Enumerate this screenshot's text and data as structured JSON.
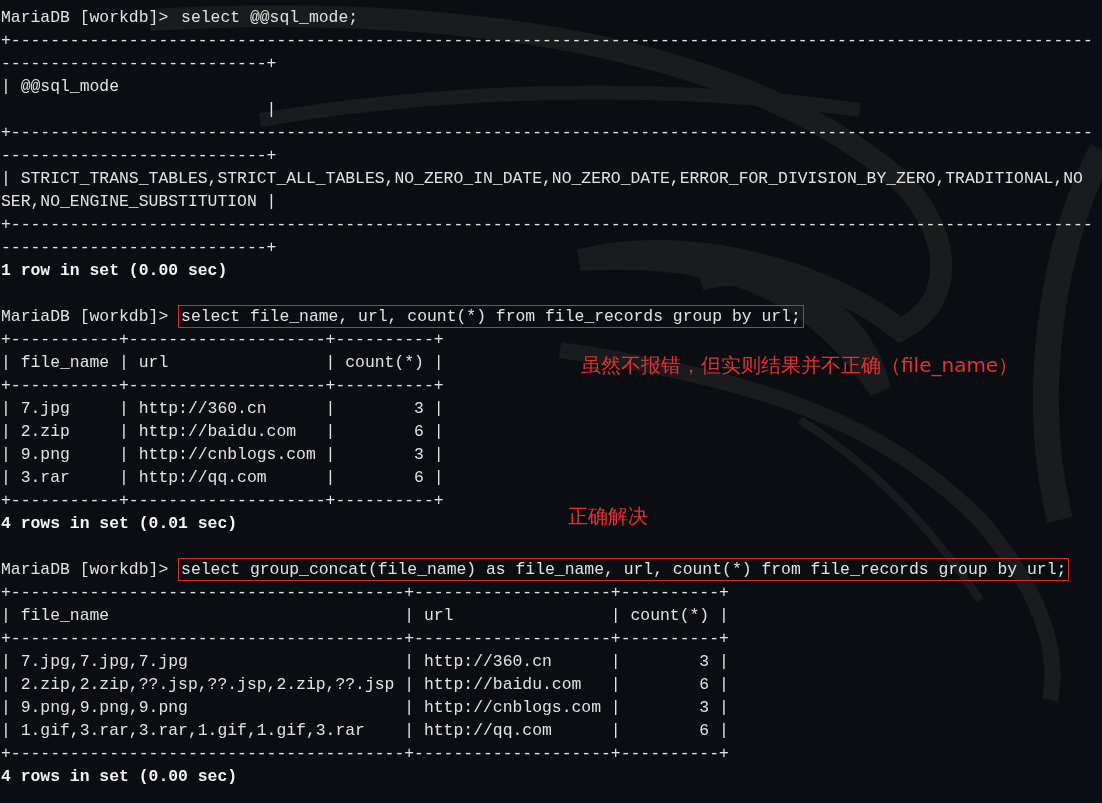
{
  "lines": [
    {
      "kind": "command",
      "prompt": "MariaDB [workdb]> ",
      "command": "select @@sql_mode;",
      "highlighted": false
    },
    {
      "kind": "border",
      "text": "+--------------------------------------------------------------------------------------------------------------"
    },
    {
      "kind": "border",
      "text": "---------------------------+"
    },
    {
      "kind": "row",
      "text": "| @@sql_mode"
    },
    {
      "kind": "row",
      "text": "                           |"
    },
    {
      "kind": "border",
      "text": "+--------------------------------------------------------------------------------------------------------------"
    },
    {
      "kind": "border",
      "text": "---------------------------+"
    },
    {
      "kind": "row",
      "text": "| STRICT_TRANS_TABLES,STRICT_ALL_TABLES,NO_ZERO_IN_DATE,NO_ZERO_DATE,ERROR_FOR_DIVISION_BY_ZERO,TRADITIONAL,NO"
    },
    {
      "kind": "row",
      "text": "SER,NO_ENGINE_SUBSTITUTION |"
    },
    {
      "kind": "border",
      "text": "+--------------------------------------------------------------------------------------------------------------"
    },
    {
      "kind": "border",
      "text": "---------------------------+"
    },
    {
      "kind": "summary",
      "text": "1 row in set (0.00 sec)"
    },
    {
      "kind": "blank"
    },
    {
      "kind": "command",
      "prompt": "MariaDB [workdb]> ",
      "command": "select file_name, url, count(*) from file_records group by url;",
      "highlighted": true
    },
    {
      "kind": "border",
      "text": "+-----------+--------------------+----------+"
    },
    {
      "kind": "row",
      "text": "| file_name | url                | count(*) |",
      "note": "虽然不报错，但实则结果并不正确（file_name）"
    },
    {
      "kind": "border",
      "text": "+-----------+--------------------+----------+"
    },
    {
      "kind": "row",
      "text": "| 7.jpg     | http://360.cn      |        3 |"
    },
    {
      "kind": "row",
      "text": "| 2.zip     | http://baidu.com   |        6 |"
    },
    {
      "kind": "row",
      "text": "| 9.png     | http://cnblogs.com |        3 |"
    },
    {
      "kind": "row",
      "text": "| 3.rar     | http://qq.com      |        6 |"
    },
    {
      "kind": "border",
      "text": "+-----------+--------------------+----------+"
    },
    {
      "kind": "summary",
      "text": "4 rows in set (0.01 sec)",
      "note": "正确解决"
    },
    {
      "kind": "blank"
    },
    {
      "kind": "command",
      "prompt": "MariaDB [workdb]> ",
      "command": "select group_concat(file_name) as file_name, url, count(*) from file_records group by url;",
      "highlighted": true
    },
    {
      "kind": "border",
      "text": "+----------------------------------------+--------------------+----------+"
    },
    {
      "kind": "row",
      "text": "| file_name                              | url                | count(*) |"
    },
    {
      "kind": "border",
      "text": "+----------------------------------------+--------------------+----------+"
    },
    {
      "kind": "row",
      "text": "| 7.jpg,7.jpg,7.jpg                      | http://360.cn      |        3 |"
    },
    {
      "kind": "row",
      "text": "| 2.zip,2.zip,??.jsp,??.jsp,2.zip,??.jsp | http://baidu.com   |        6 |"
    },
    {
      "kind": "row",
      "text": "| 9.png,9.png,9.png                      | http://cnblogs.com |        3 |"
    },
    {
      "kind": "row",
      "text": "| 1.gif,3.rar,3.rar,1.gif,1.gif,3.rar    | http://qq.com      |        6 |"
    },
    {
      "kind": "border",
      "text": "+----------------------------------------+--------------------+----------+"
    },
    {
      "kind": "summary",
      "text": "4 rows in set (0.00 sec)"
    }
  ]
}
